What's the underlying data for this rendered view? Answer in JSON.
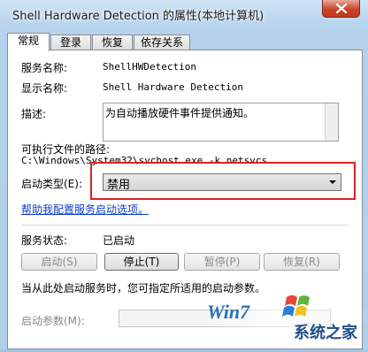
{
  "window": {
    "title": "Shell Hardware Detection 的属性(本地计算机)"
  },
  "tabs": [
    "常规",
    "登录",
    "恢复",
    "依存关系"
  ],
  "general": {
    "service_name_label": "服务名称:",
    "service_name_value": "ShellHWDetection",
    "display_name_label": "显示名称:",
    "display_name_value": "Shell Hardware Detection",
    "description_label": "描述:",
    "description_value": "为自动播放硬件事件提供通知。",
    "exe_path_label": "可执行文件的路径:",
    "exe_path_value": "C:\\Windows\\System32\\svchost.exe -k netsvcs",
    "startup_type_label": "启动类型(E):",
    "startup_type_value": "禁用",
    "help_link": "帮助我配置服务启动选项。",
    "status_label": "服务状态:",
    "status_value": "已启动",
    "buttons": {
      "start": "启动(S)",
      "stop": "停止(T)",
      "pause": "暂停(P)",
      "resume": "恢复(R)"
    },
    "hint": "当从此处启动服务时，您可指定所适用的启动参数。",
    "start_params_label": "启动参数(M):",
    "start_params_value": ""
  },
  "watermark": {
    "brand": "Win7",
    "site_name": "系统之家"
  }
}
